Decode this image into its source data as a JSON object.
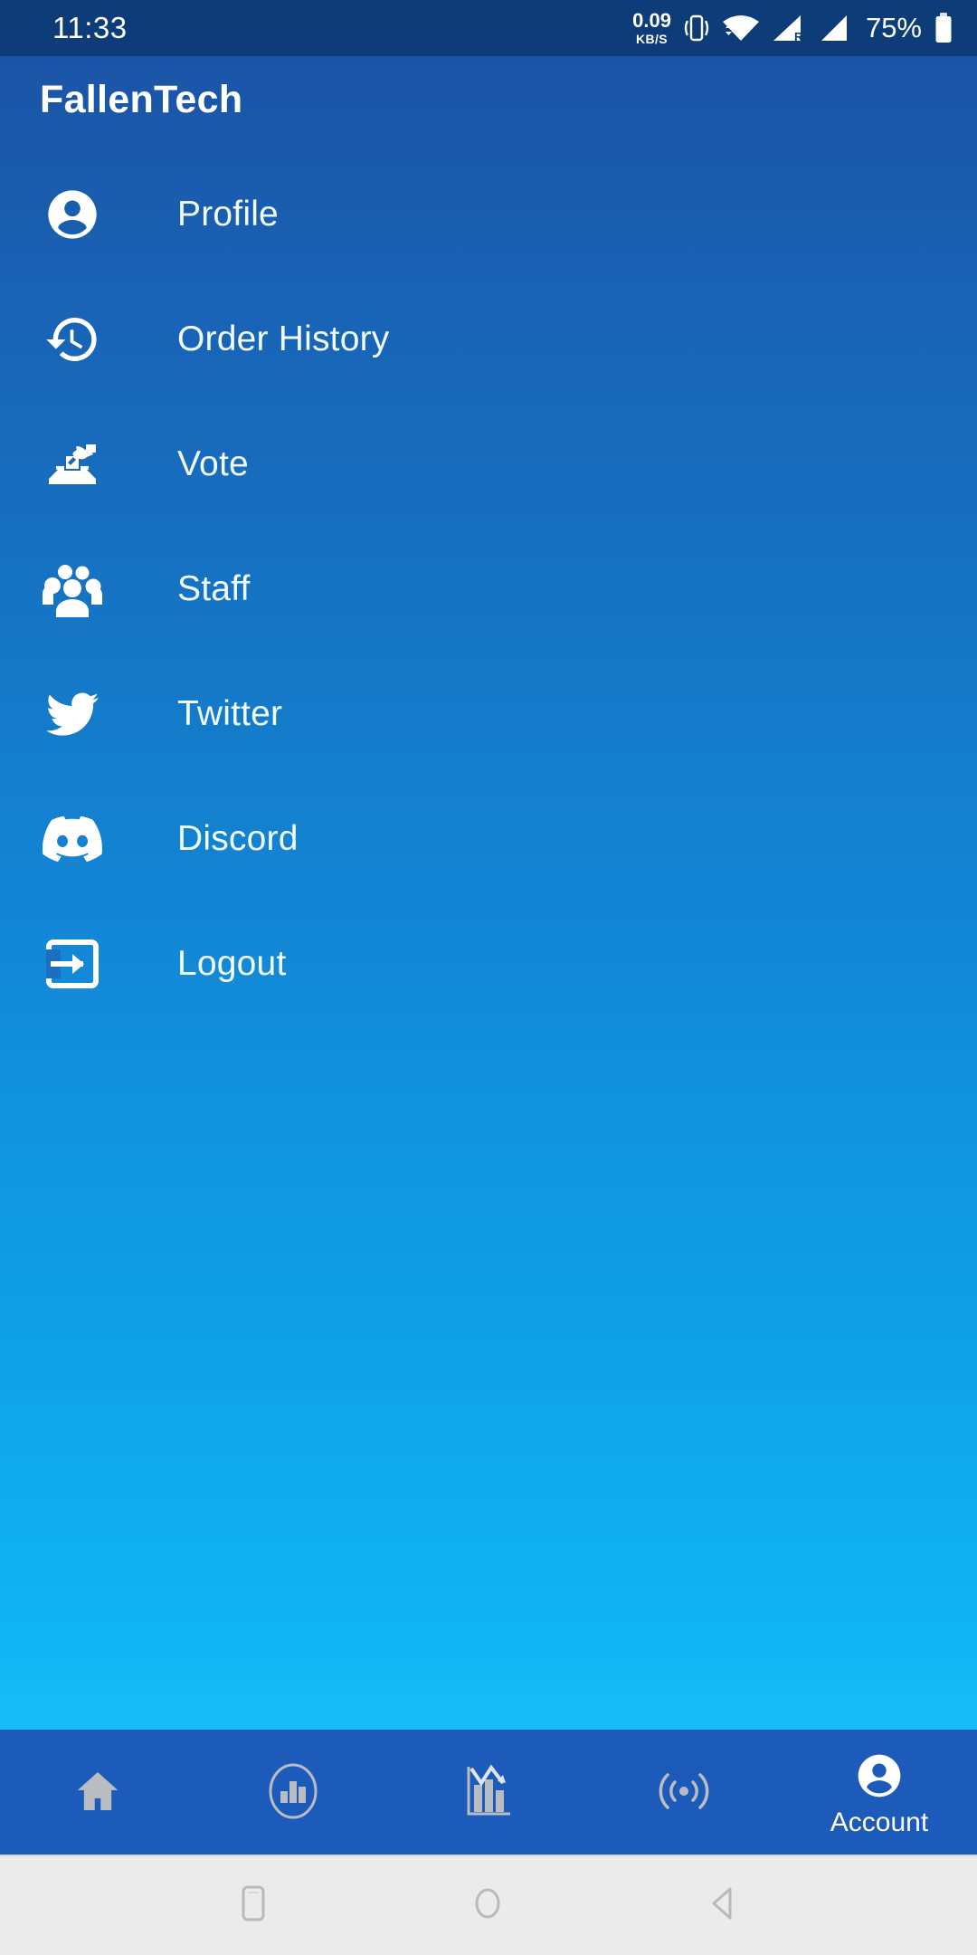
{
  "status_bar": {
    "clock": "11:33",
    "net_speed_value": "0.09",
    "net_speed_unit": "KB/S",
    "vibrate_icon": "vibrate-icon",
    "wifi_icon": "wifi-icon",
    "signal_roaming_icon": "signal-roaming-icon",
    "signal_icon": "signal-icon",
    "battery_percent": "75%",
    "battery_icon": "battery-icon",
    "background_color": "#0d3c78",
    "text_color": "#ffffff"
  },
  "drawer": {
    "title": "FallenTech",
    "gradient_top": "#1b54a6",
    "gradient_bottom": "#17bcf8",
    "items": [
      {
        "label": "Profile",
        "icon": "account-circle-icon"
      },
      {
        "label": "Order History",
        "icon": "history-clock-icon"
      },
      {
        "label": "Vote",
        "icon": "ballot-box-icon"
      },
      {
        "label": "Staff",
        "icon": "people-group-icon"
      },
      {
        "label": "Twitter",
        "icon": "twitter-bird-icon"
      },
      {
        "label": "Discord",
        "icon": "discord-icon"
      },
      {
        "label": "Logout",
        "icon": "exit-to-app-icon"
      }
    ]
  },
  "bottom_nav": {
    "background_color": "#1d5bba",
    "inactive_color": "#b9bdc2",
    "active_color": "#ffffff",
    "items": [
      {
        "label": "",
        "icon": "home-icon",
        "active": false
      },
      {
        "label": "",
        "icon": "bar-chart-circle-icon",
        "active": false
      },
      {
        "label": "",
        "icon": "chart-trend-icon",
        "active": false
      },
      {
        "label": "",
        "icon": "broadcast-icon",
        "active": false
      },
      {
        "label": "Account",
        "icon": "account-circle-icon",
        "active": true
      }
    ]
  },
  "system_nav": {
    "background_color": "#ebebeb",
    "recents_icon": "recents-square-icon",
    "home_icon": "home-circle-icon",
    "back_icon": "back-triangle-icon"
  }
}
